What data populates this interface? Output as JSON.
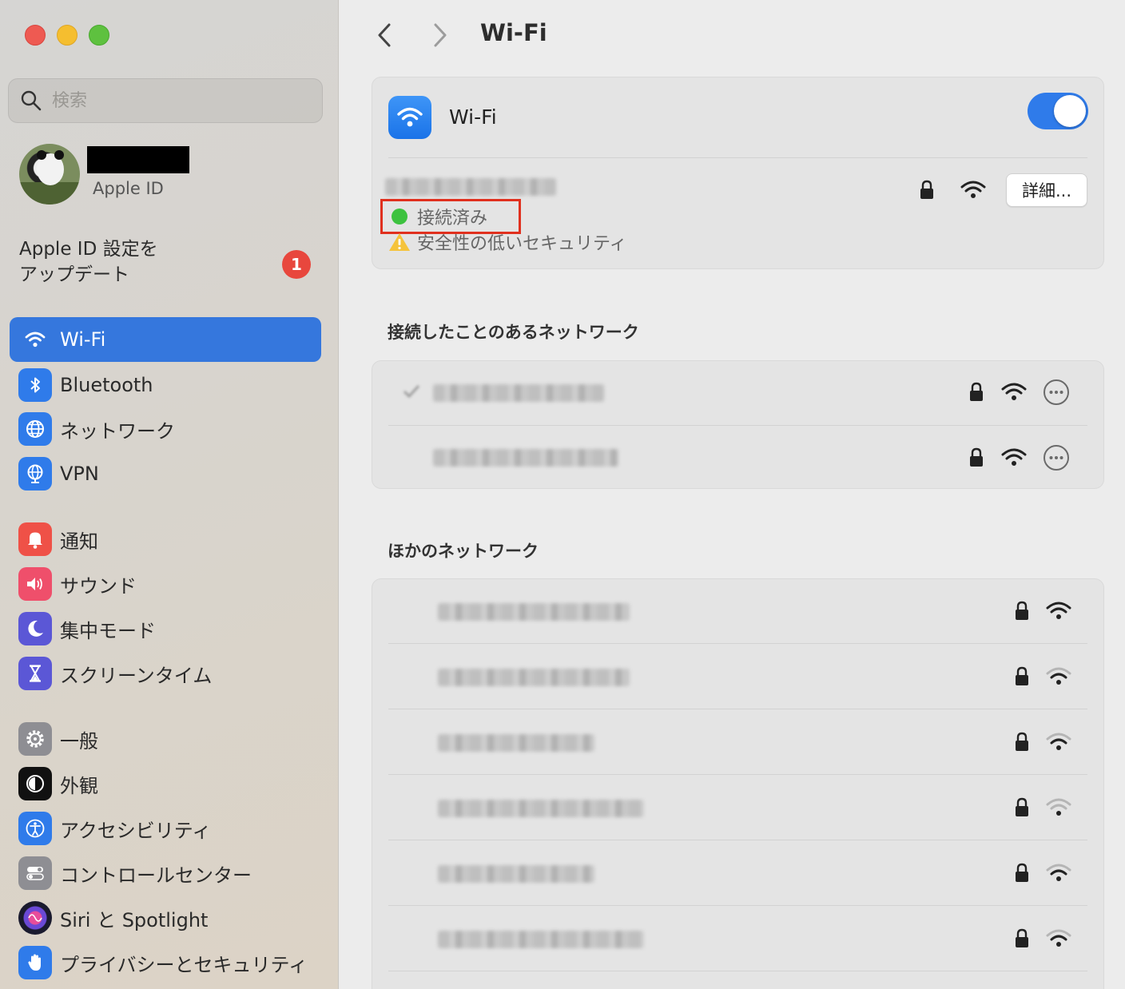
{
  "window": {
    "title": "Wi-Fi"
  },
  "sidebar": {
    "search_placeholder": "検索",
    "profile": {
      "apple_id_label": "Apple ID"
    },
    "update": {
      "text": "Apple ID 設定を\nアップデート",
      "badge": "1"
    },
    "items": [
      {
        "label": "Wi-Fi",
        "icon": "wifi-icon",
        "color": "#3577dd",
        "active": true
      },
      {
        "label": "Bluetooth",
        "icon": "bluetooth-icon",
        "color": "#2f7bea"
      },
      {
        "label": "ネットワーク",
        "icon": "globe-icon",
        "color": "#2f7bea"
      },
      {
        "label": "VPN",
        "icon": "vpn-globe-icon",
        "color": "#2f7bea"
      },
      {
        "label": "通知",
        "icon": "bell-icon",
        "color": "#ef5147"
      },
      {
        "label": "サウンド",
        "icon": "speaker-icon",
        "color": "#ef4f6b"
      },
      {
        "label": "集中モード",
        "icon": "moon-icon",
        "color": "#5b57d6"
      },
      {
        "label": "スクリーンタイム",
        "icon": "hourglass-icon",
        "color": "#5b57d6"
      },
      {
        "label": "一般",
        "icon": "gear-icon",
        "color": "#8e8e93"
      },
      {
        "label": "外観",
        "icon": "appearance-icon",
        "color": "#111111"
      },
      {
        "label": "アクセシビリティ",
        "icon": "accessibility-icon",
        "color": "#2f7bea"
      },
      {
        "label": "コントロールセンター",
        "icon": "toggles-icon",
        "color": "#8e8e93"
      },
      {
        "label": "Siri と Spotlight",
        "icon": "siri-icon",
        "color": "#222222"
      },
      {
        "label": "プライバシーとセキュリティ",
        "icon": "hand-icon",
        "color": "#2f7bea"
      }
    ]
  },
  "main": {
    "title": "Wi-Fi",
    "wifi_card": {
      "label": "Wi-Fi",
      "toggle_on": true,
      "status": "接続済み",
      "warning": "安全性の低いセキュリティ",
      "detail_button": "詳細..."
    },
    "known_networks": {
      "title": "接続したことのあるネットワーク"
    },
    "other_networks": {
      "title": "ほかのネットワーク"
    }
  },
  "colors": {
    "accent": "#3577dd",
    "connected": "#3dc23f",
    "highlight_box": "#e0301e"
  }
}
